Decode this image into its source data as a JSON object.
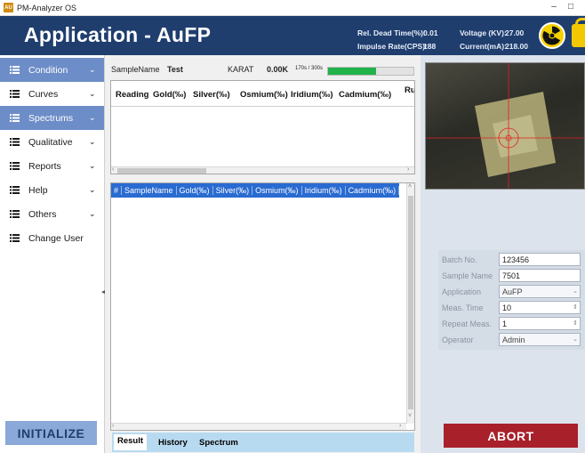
{
  "window": {
    "title": "PM-Analyzer OS",
    "icon_label": "AU",
    "minimize": "–",
    "maximize": "□"
  },
  "header": {
    "title": "Application - AuFP",
    "rel_dead_time_label": "Rel. Dead Time(%):",
    "rel_dead_time_value": "0.01",
    "impulse_rate_label": "Impulse Rate(CPS):",
    "impulse_rate_value": "188",
    "voltage_label": "Voltage (KV):",
    "voltage_value": "27.00",
    "current_label": "Current(mA):",
    "current_value": "218.00",
    "icons": [
      "radiation-icon",
      "lock-icon"
    ]
  },
  "sidebar": {
    "items": [
      {
        "label": "Condition",
        "active": true,
        "chevron": true
      },
      {
        "label": "Curves",
        "active": false,
        "chevron": true
      },
      {
        "label": "Spectrums",
        "active": true,
        "chevron": true
      },
      {
        "label": "Qualitative",
        "active": false,
        "chevron": true
      },
      {
        "label": "Reports",
        "active": false,
        "chevron": true
      },
      {
        "label": "Help",
        "active": false,
        "chevron": true
      },
      {
        "label": "Others",
        "active": false,
        "chevron": true
      },
      {
        "label": "Change User",
        "active": false,
        "chevron": false
      }
    ],
    "initialize_label": "INITIALIZE",
    "accent": "#6d8dc8"
  },
  "sample": {
    "name_label": "SampleName",
    "name_value": "Test",
    "karat_label": "KARAT",
    "karat_value": "0.00K",
    "time_label": "170s / 300s",
    "progress_fraction": 0.567
  },
  "reading_table": {
    "columns": [
      "Reading",
      "Gold(‰)",
      "Silver(‰)",
      "Osmium(‰)",
      "Iridium(‰)",
      "Cadmium(‰)",
      "Ru"
    ]
  },
  "results_table": {
    "columns": [
      "#",
      "SampleName",
      "Gold(‰)",
      "Silver(‰)",
      "Osmium(‰)",
      "Iridium(‰)",
      "Cadmium(‰)"
    ]
  },
  "tabs": [
    "Result",
    "History",
    "Spectrum"
  ],
  "form": {
    "fields": [
      {
        "label": "Batch No.",
        "value": "123456",
        "type": "text"
      },
      {
        "label": "Sample Name",
        "value": "7501",
        "type": "text"
      },
      {
        "label": "Application",
        "value": "AuFP",
        "type": "select"
      },
      {
        "label": "Meas. Time",
        "value": "10",
        "type": "spin"
      },
      {
        "label": "Repeat Meas.",
        "value": "1",
        "type": "spin"
      },
      {
        "label": "Operator",
        "value": "Admin",
        "type": "select"
      }
    ]
  },
  "abort_label": "ABORT",
  "camera": {
    "crosshair_color": "#e02020"
  }
}
